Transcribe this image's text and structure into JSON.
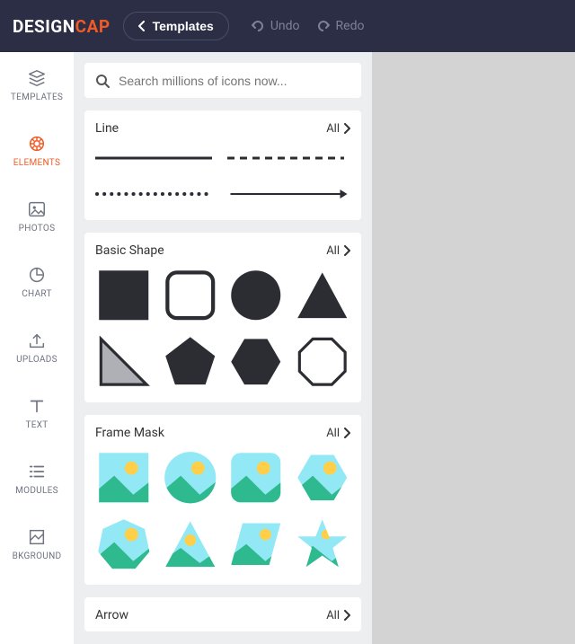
{
  "topbar": {
    "logo_part1": "DESIGN",
    "logo_part2": "CAP",
    "templates_label": "Templates",
    "undo_label": "Undo",
    "redo_label": "Redo"
  },
  "sidebar": {
    "items": [
      {
        "label": "TEMPLATES"
      },
      {
        "label": "ELEMENTS"
      },
      {
        "label": "PHOTOS"
      },
      {
        "label": "CHART"
      },
      {
        "label": "UPLOADS"
      },
      {
        "label": "TEXT"
      },
      {
        "label": "MODULES"
      },
      {
        "label": "BKGROUND"
      }
    ]
  },
  "search": {
    "placeholder": "Search millions of icons now..."
  },
  "sections": {
    "line": {
      "title": "Line",
      "all": "All"
    },
    "basic_shape": {
      "title": "Basic Shape",
      "all": "All"
    },
    "frame_mask": {
      "title": "Frame Mask",
      "all": "All"
    },
    "arrow": {
      "title": "Arrow",
      "all": "All"
    }
  },
  "colors": {
    "accent": "#f15a24",
    "topbar": "#2b2e44",
    "shape": "#2b2d33",
    "frame_bg": "#93e8f5",
    "frame_sun": "#ffcf4a",
    "frame_hill": "#2fb98f"
  }
}
